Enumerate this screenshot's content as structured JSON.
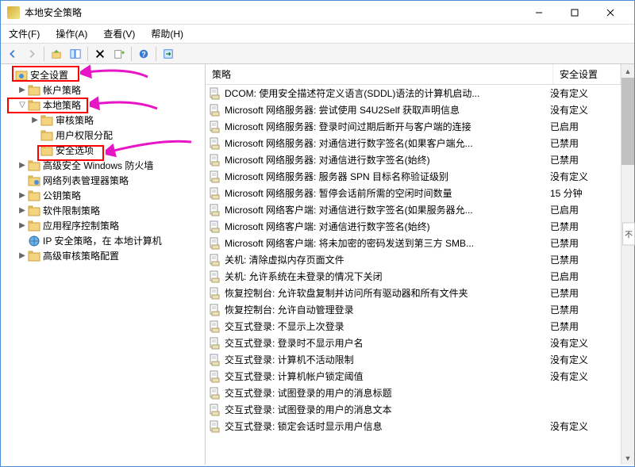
{
  "window": {
    "title": "本地安全策略"
  },
  "menubar": {
    "file": "文件(F)",
    "action": "操作(A)",
    "view": "查看(V)",
    "help": "帮助(H)"
  },
  "tree": {
    "root": "安全设置",
    "items": [
      {
        "label": "帐户策略",
        "level": 1,
        "arrow": "▶",
        "icon": "folder"
      },
      {
        "label": "本地策略",
        "level": 1,
        "arrow": "▽",
        "icon": "folder"
      },
      {
        "label": "审核策略",
        "level": 2,
        "arrow": "▶",
        "icon": "folder"
      },
      {
        "label": "用户权限分配",
        "level": 2,
        "arrow": "",
        "icon": "folder"
      },
      {
        "label": "安全选项",
        "level": 2,
        "arrow": "",
        "icon": "folder"
      },
      {
        "label": "高级安全 Windows 防火墙",
        "level": 1,
        "arrow": "▶",
        "icon": "folder"
      },
      {
        "label": "网络列表管理器策略",
        "level": 1,
        "arrow": "",
        "icon": "folder-net"
      },
      {
        "label": "公钥策略",
        "level": 1,
        "arrow": "▶",
        "icon": "folder"
      },
      {
        "label": "软件限制策略",
        "level": 1,
        "arrow": "▶",
        "icon": "folder"
      },
      {
        "label": "应用程序控制策略",
        "level": 1,
        "arrow": "▶",
        "icon": "folder"
      },
      {
        "label": "IP 安全策略，在 本地计算机",
        "level": 1,
        "arrow": "",
        "icon": "ipsec"
      },
      {
        "label": "高级审核策略配置",
        "level": 1,
        "arrow": "▶",
        "icon": "folder"
      }
    ]
  },
  "list": {
    "header": {
      "policy": "策略",
      "setting": "安全设置"
    },
    "rows": [
      {
        "policy": "DCOM: 使用安全描述符定义语言(SDDL)语法的计算机启动...",
        "setting": "没有定义"
      },
      {
        "policy": "Microsoft 网络服务器: 尝试使用 S4U2Self 获取声明信息",
        "setting": "没有定义"
      },
      {
        "policy": "Microsoft 网络服务器: 登录时间过期后断开与客户端的连接",
        "setting": "已启用"
      },
      {
        "policy": "Microsoft 网络服务器: 对通信进行数字签名(如果客户端允...",
        "setting": "已禁用"
      },
      {
        "policy": "Microsoft 网络服务器: 对通信进行数字签名(始终)",
        "setting": "已禁用"
      },
      {
        "policy": "Microsoft 网络服务器: 服务器 SPN 目标名称验证级别",
        "setting": "没有定义"
      },
      {
        "policy": "Microsoft 网络服务器: 暂停会话前所需的空闲时间数量",
        "setting": "15 分钟"
      },
      {
        "policy": "Microsoft 网络客户端: 对通信进行数字签名(如果服务器允...",
        "setting": "已启用"
      },
      {
        "policy": "Microsoft 网络客户端: 对通信进行数字签名(始终)",
        "setting": "已禁用"
      },
      {
        "policy": "Microsoft 网络客户端: 将未加密的密码发送到第三方 SMB...",
        "setting": "已禁用"
      },
      {
        "policy": "关机: 清除虚拟内存页面文件",
        "setting": "已禁用"
      },
      {
        "policy": "关机: 允许系统在未登录的情况下关闭",
        "setting": "已启用"
      },
      {
        "policy": "恢复控制台: 允许软盘复制并访问所有驱动器和所有文件夹",
        "setting": "已禁用"
      },
      {
        "policy": "恢复控制台: 允许自动管理登录",
        "setting": "已禁用"
      },
      {
        "policy": "交互式登录: 不显示上次登录",
        "setting": "已禁用"
      },
      {
        "policy": "交互式登录: 登录时不显示用户名",
        "setting": "没有定义"
      },
      {
        "policy": "交互式登录: 计算机不活动限制",
        "setting": "没有定义"
      },
      {
        "policy": "交互式登录: 计算机帐户锁定阈值",
        "setting": "没有定义"
      },
      {
        "policy": "交互式登录: 试图登录的用户的消息标题",
        "setting": ""
      },
      {
        "policy": "交互式登录: 试图登录的用户的消息文本",
        "setting": ""
      },
      {
        "policy": "交互式登录: 锁定会话时显示用户信息",
        "setting": "没有定义"
      }
    ]
  },
  "side_caret": "不"
}
